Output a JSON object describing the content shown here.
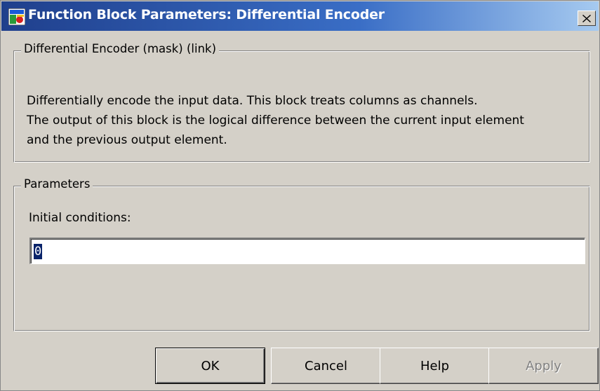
{
  "window": {
    "title": "Function Block Parameters: Differential Encoder",
    "icon": "simulink-block-icon",
    "close_label": "×"
  },
  "description_group": {
    "legend": "Differential Encoder (mask) (link)",
    "line1": "Differentially encode the input data. This block treats columns as channels.",
    "line2": "The output of this block is the logical difference between the current input element",
    "line3": "and the previous output element."
  },
  "parameters_group": {
    "legend": "Parameters",
    "initial_conditions_label": "Initial conditions:",
    "initial_conditions_value": "0"
  },
  "buttons": {
    "ok": "OK",
    "cancel": "Cancel",
    "help": "Help",
    "apply": "Apply"
  },
  "colors": {
    "titlebar_start": "#1f3f8c",
    "titlebar_end": "#a6caf0",
    "dialog_bg": "#d4d0c8",
    "selection": "#0a246a"
  }
}
